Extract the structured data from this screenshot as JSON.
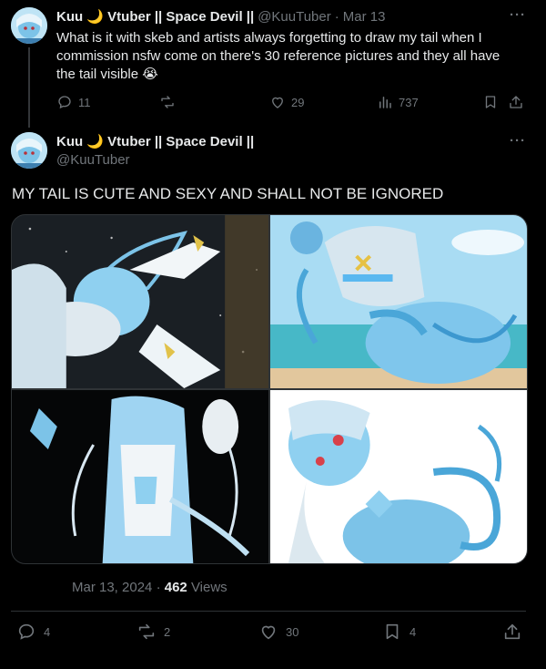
{
  "reply_tweet": {
    "name": "Kuu 🌙 Vtuber || Space Devil ||",
    "handle": "@KuuTuber",
    "separator": "·",
    "date": "Mar 13",
    "more": "···",
    "text": "What is it with skeb and artists always forgetting to draw my tail when I commission nsfw come on there's 30 reference pictures and they all have the tail visible 😭",
    "actions": {
      "replies": "11",
      "reposts": "",
      "likes": "29",
      "views": "737"
    }
  },
  "main_tweet": {
    "name": "Kuu 🌙 Vtuber || Space Devil ||",
    "handle": "@KuuTuber",
    "more": "···",
    "text": "MY TAIL IS CUTE AND SEXY AND SHALL NOT BE IGNORED",
    "images": [
      {
        "icon": "illustration-space-backdrop"
      },
      {
        "icon": "illustration-beach-backdrop"
      },
      {
        "icon": "illustration-dark-backdrop"
      },
      {
        "icon": "illustration-white-backdrop"
      }
    ],
    "date": "Mar 13, 2024",
    "dot": "·",
    "views_count": "462",
    "views_label": "Views",
    "actions": {
      "replies": "4",
      "reposts": "2",
      "likes": "30",
      "bookmarks": "4"
    }
  },
  "colors": {
    "background": "#000000",
    "text": "#e7e9ea",
    "muted": "#71767b",
    "border": "#2f3336"
  }
}
